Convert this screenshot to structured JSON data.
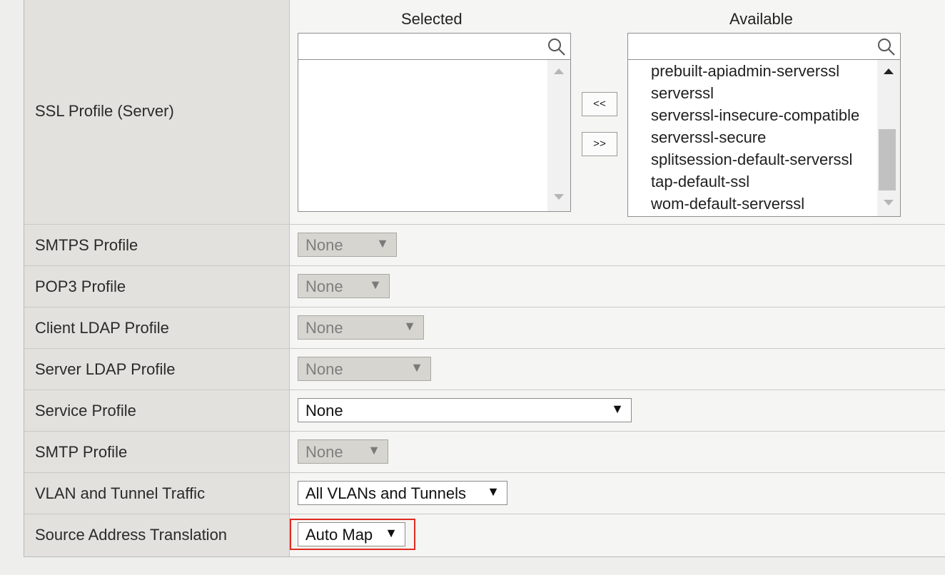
{
  "ssl_profile": {
    "label": "SSL Profile (Server)",
    "selected_title": "Selected",
    "available_title": "Available",
    "selected_search_value": "",
    "available_search_value": "",
    "selected_items": [],
    "available_items": [
      "prebuilt-apiadmin-serverssl",
      "serverssl",
      "serverssl-insecure-compatible",
      "serverssl-secure",
      "splitsession-default-serverssl",
      "tap-default-ssl",
      "wom-default-serverssl"
    ],
    "move_left_label": "<<",
    "move_right_label": ">>"
  },
  "rows": [
    {
      "label": "SMTPS Profile",
      "value": "None",
      "enabled": false
    },
    {
      "label": "POP3 Profile",
      "value": "None",
      "enabled": false
    },
    {
      "label": "Client LDAP Profile",
      "value": "None",
      "enabled": false
    },
    {
      "label": "Server LDAP Profile",
      "value": "None",
      "enabled": false
    },
    {
      "label": "Service Profile",
      "value": "None",
      "enabled": true
    },
    {
      "label": "SMTP Profile",
      "value": "None",
      "enabled": false
    },
    {
      "label": "VLAN and Tunnel Traffic",
      "value": "All VLANs and Tunnels",
      "enabled": true
    },
    {
      "label": "Source Address Translation",
      "value": "Auto Map",
      "enabled": true,
      "highlighted": true
    }
  ],
  "dropdown_arrow": "▼",
  "colors": {
    "highlight_border": "#e02b20",
    "disabled_select_bg": "#d7d5d0"
  }
}
